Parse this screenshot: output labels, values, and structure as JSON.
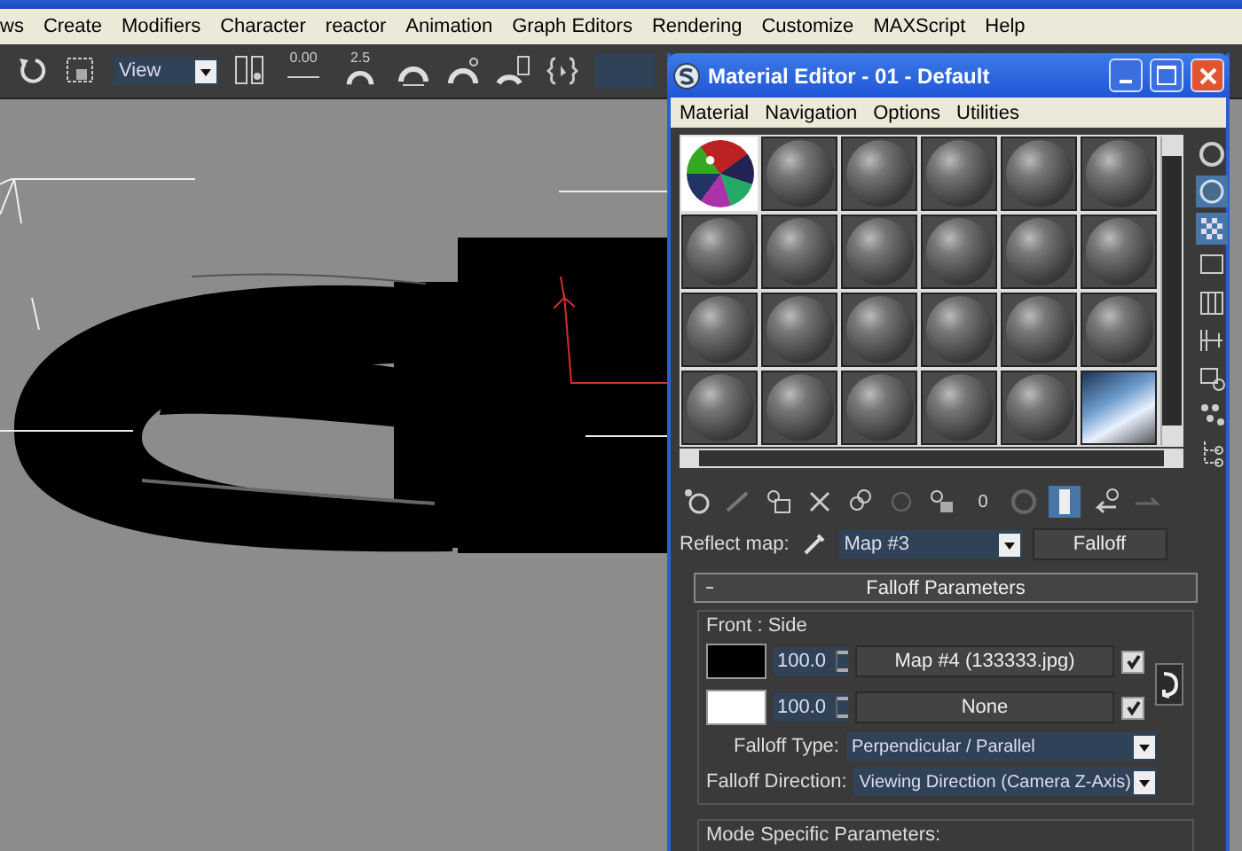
{
  "menu_bar": [
    {
      "label": "ws"
    },
    {
      "label": "Create"
    },
    {
      "label": "Modifiers"
    },
    {
      "label": "Character"
    },
    {
      "label": "reactor"
    },
    {
      "label": "Animation"
    },
    {
      "label": "Graph Editors"
    },
    {
      "label": "Rendering"
    },
    {
      "label": "Customize"
    },
    {
      "label": "MAXScript"
    },
    {
      "label": "Help"
    }
  ],
  "toolbar": {
    "reference_dropdown": "View",
    "spinner_snap_value": "0.00",
    "angle_snap_value": "2.5"
  },
  "material_editor": {
    "title": "Material Editor - 01 - Default",
    "menu": [
      {
        "label": "Material"
      },
      {
        "label": "Navigation"
      },
      {
        "label": "Options"
      },
      {
        "label": "Utilities"
      }
    ],
    "sample_slots": [
      {
        "kind": "texture",
        "selected": true
      },
      {
        "kind": "sphere",
        "selected": false
      },
      {
        "kind": "sphere",
        "selected": false
      },
      {
        "kind": "sphere",
        "selected": false
      },
      {
        "kind": "sphere",
        "selected": false
      },
      {
        "kind": "sphere",
        "selected": false
      },
      {
        "kind": "sphere",
        "selected": false
      },
      {
        "kind": "sphere",
        "selected": false
      },
      {
        "kind": "sphere",
        "selected": false
      },
      {
        "kind": "sphere",
        "selected": false
      },
      {
        "kind": "sphere",
        "selected": false
      },
      {
        "kind": "sphere",
        "selected": false
      },
      {
        "kind": "sphere",
        "selected": false
      },
      {
        "kind": "sphere",
        "selected": false
      },
      {
        "kind": "sphere",
        "selected": false
      },
      {
        "kind": "sphere",
        "selected": false
      },
      {
        "kind": "sphere",
        "selected": false
      },
      {
        "kind": "sphere",
        "selected": false
      },
      {
        "kind": "sphere",
        "selected": false
      },
      {
        "kind": "sphere",
        "selected": false
      },
      {
        "kind": "sphere",
        "selected": false
      },
      {
        "kind": "sphere",
        "selected": false
      },
      {
        "kind": "sphere",
        "selected": false
      },
      {
        "kind": "photo",
        "selected": false
      }
    ],
    "toolbar_value": "0",
    "reflect_map": {
      "label": "Reflect map:",
      "map": "Map #3",
      "type_button": "Falloff"
    },
    "rollout": {
      "title": "Falloff Parameters",
      "expanded": true,
      "group_title": "Front : Side",
      "rows": [
        {
          "color": "#000000",
          "amount": "100.0",
          "map": "Map #4 (133333.jpg)",
          "checked": true
        },
        {
          "color": "#ffffff",
          "amount": "100.0",
          "map": "None",
          "checked": true
        }
      ],
      "falloff_type": {
        "label": "Falloff Type:",
        "value": "Perpendicular / Parallel"
      },
      "falloff_direction": {
        "label": "Falloff Direction:",
        "value": "Viewing Direction (Camera Z-Axis)"
      },
      "mode_section": "Mode Specific Parameters:"
    }
  }
}
